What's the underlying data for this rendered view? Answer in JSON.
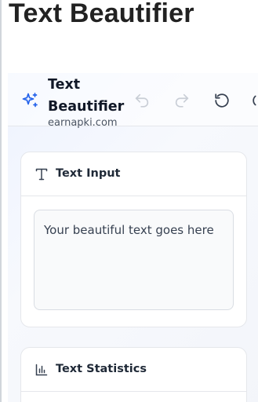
{
  "page": {
    "title": "Text Beautifier"
  },
  "header": {
    "brand_name": "Text Beautifier",
    "brand_sub": "earnapki.com",
    "icons": [
      "sparkles-icon",
      "undo-icon",
      "redo-icon",
      "reset-icon"
    ]
  },
  "input_card": {
    "title": "Text Input",
    "icon": "type-icon",
    "text": "Your beautiful text goes here"
  },
  "stats_card": {
    "title": "Text Statistics",
    "icon": "bar-chart-icon"
  },
  "colors": {
    "accent": "#2563eb",
    "icon_gray": "#6b7280",
    "disabled_gray": "#c9ced6"
  }
}
